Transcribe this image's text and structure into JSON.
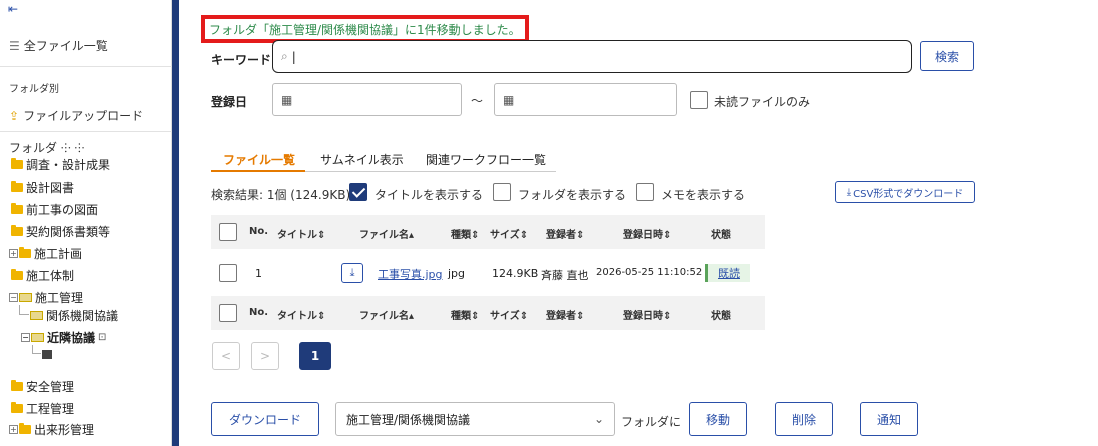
{
  "sidebar": {
    "back_icon": "arrow-left-bar-icon",
    "all_files_label": "全ファイル一覧",
    "by_folder_label": "フォルダ別",
    "upload_label": "ファイルアップロード",
    "folder_header": "フォルダ ⸭ ⸭",
    "tree": [
      {
        "label": "調査・設計成果"
      },
      {
        "label": "設計図書"
      },
      {
        "label": "前工事の図面"
      },
      {
        "label": "契約関係書類等"
      },
      {
        "label": "施工計画"
      },
      {
        "label": "施工体制"
      },
      {
        "label": "施工管理"
      },
      {
        "label": "関係機関協議"
      },
      {
        "label": "近隣協議"
      },
      {
        "label": "安全管理"
      },
      {
        "label": "工程管理"
      },
      {
        "label": "出来形管理"
      }
    ]
  },
  "main": {
    "toast": "フォルダ「施工管理/関係機関協議」に1件移動しました。",
    "keyword_label": "キーワード",
    "keyword_value": "",
    "search_button": "検索",
    "date_label": "登録日",
    "tilde": "～",
    "unread_label": "未読ファイルのみ",
    "tabs": [
      "ファイル一覧",
      "サムネイル表示",
      "関連ワークフロー一覧"
    ],
    "result_summary": "検索結果: 1個 (124.9KB)",
    "show_title_label": "タイトルを表示する",
    "show_folder_label": "フォルダを表示する",
    "show_memo_label": "メモを表示する",
    "csv_button": "CSV形式でダウンロード",
    "columns": [
      "No.",
      "タイトル",
      "ファイル名",
      "種類",
      "サイズ",
      "登録者",
      "登録日時",
      "状態"
    ],
    "column_sort_marks": [
      "",
      "⇕",
      "▴",
      "⇕",
      "⇕",
      "⇕",
      "⇕",
      ""
    ],
    "rows": [
      {
        "no": "1",
        "title": "",
        "filename": "工事写真.jpg",
        "type": "jpg",
        "size": "124.9KB",
        "user": "斉藤 直也",
        "datetime": "2026-05-25 11:10:52",
        "status": "既読"
      }
    ],
    "pagination": {
      "prev": "<",
      "next": ">",
      "current": "1"
    },
    "download_button": "ダウンロード",
    "move_target": "施工管理/関係機関協議",
    "move_suffix": "フォルダに",
    "move_button": "移動",
    "delete_button": "削除",
    "notify_button": "通知"
  }
}
